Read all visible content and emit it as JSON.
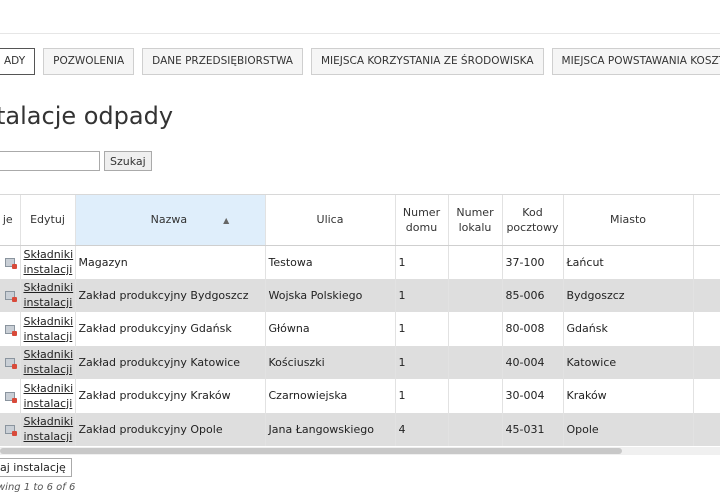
{
  "tabs": [
    {
      "label": "ADY"
    },
    {
      "label": "POZWOLENIA"
    },
    {
      "label": "DANE PRZEDSIĘBIORSTWA"
    },
    {
      "label": "MIEJSCA KORZYSTANIA ZE ŚRODOWISKA"
    },
    {
      "label": "MIEJSCA POWSTAWANIA KOSZTÓW"
    }
  ],
  "page_title": "talacje odpady",
  "search": {
    "value": "",
    "button_label": "Szukaj"
  },
  "table": {
    "headers": {
      "col0": "je",
      "edit": "Edytuj",
      "name": "Nazwa",
      "street": "Ulica",
      "house_no": "Numer domu",
      "unit_no": "Numer lokalu",
      "postal": "Kod pocztowy",
      "city": "Miasto"
    },
    "rows": [
      {
        "link1": "Składniki",
        "link2": "instalacji",
        "name": "Magazyn",
        "street": "Testowa",
        "house_no": "1",
        "unit_no": "",
        "postal": "37-100",
        "city": "Łańcut"
      },
      {
        "link1": "Składniki",
        "link2": "instalacji",
        "name": "Zakład produkcyjny Bydgoszcz",
        "street": "Wojska Polskiego",
        "house_no": "1",
        "unit_no": "",
        "postal": "85-006",
        "city": "Bydgoszcz"
      },
      {
        "link1": "Składniki",
        "link2": "instalacji",
        "name": "Zakład produkcyjny Gdańsk",
        "street": "Główna",
        "house_no": "1",
        "unit_no": "",
        "postal": "80-008",
        "city": "Gdańsk"
      },
      {
        "link1": "Składniki",
        "link2": "instalacji",
        "name": "Zakład produkcyjny Katowice",
        "street": "Kościuszki",
        "house_no": "1",
        "unit_no": "",
        "postal": "40-004",
        "city": "Katowice"
      },
      {
        "link1": "Składniki",
        "link2": "instalacji",
        "name": "Zakład produkcyjny Kraków",
        "street": "Czarnowiejska",
        "house_no": "1",
        "unit_no": "",
        "postal": "30-004",
        "city": "Kraków"
      },
      {
        "link1": "Składniki",
        "link2": "instalacji",
        "name": "Zakład produkcyjny Opole",
        "street": "Jana Łangowskiego",
        "house_no": "4",
        "unit_no": "",
        "postal": "45-031",
        "city": "Opole"
      }
    ]
  },
  "add_button_label": "aj instalację",
  "info_text": "wing 1 to 6 of 6"
}
